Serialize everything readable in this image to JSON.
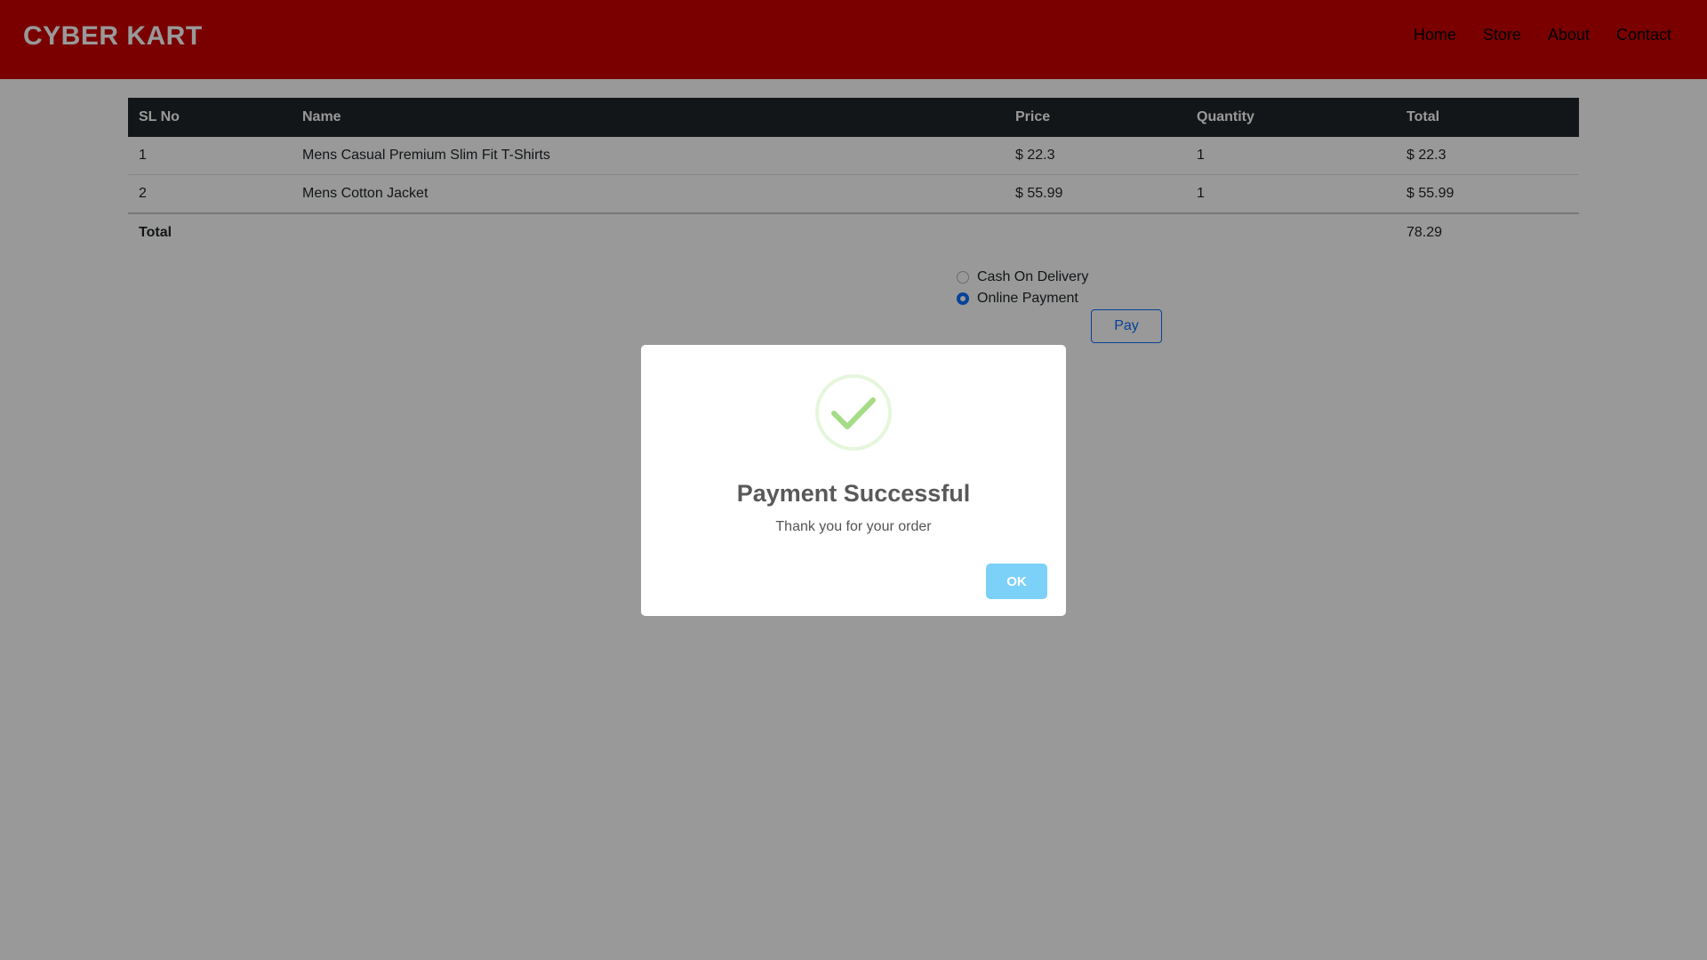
{
  "header": {
    "brand": "CYBER KART",
    "nav": [
      "Home",
      "Store",
      "About",
      "Contact"
    ]
  },
  "cart": {
    "columns": [
      "SL No",
      "Name",
      "Price",
      "Quantity",
      "Total"
    ],
    "rows": [
      {
        "sl": "1",
        "name": "Mens Casual Premium Slim Fit T-Shirts",
        "price": "$ 22.3",
        "qty": "1",
        "total": "$ 22.3"
      },
      {
        "sl": "2",
        "name": "Mens Cotton Jacket",
        "price": "$ 55.99",
        "qty": "1",
        "total": "$ 55.99"
      }
    ],
    "footer": {
      "label": "Total",
      "value": "78.29"
    }
  },
  "payment": {
    "options": [
      {
        "label": "Cash On Delivery",
        "checked": false
      },
      {
        "label": "Online Payment",
        "checked": true
      }
    ],
    "pay_label": "Pay"
  },
  "modal": {
    "title": "Payment Successful",
    "text": "Thank you for your order",
    "ok_label": "OK",
    "icon": "check-icon"
  },
  "colors": {
    "header": "#cc0000",
    "table_head": "#212529",
    "primary": "#0d6efd",
    "ok_button": "#7cd1f9",
    "success": "#a5dc86"
  }
}
